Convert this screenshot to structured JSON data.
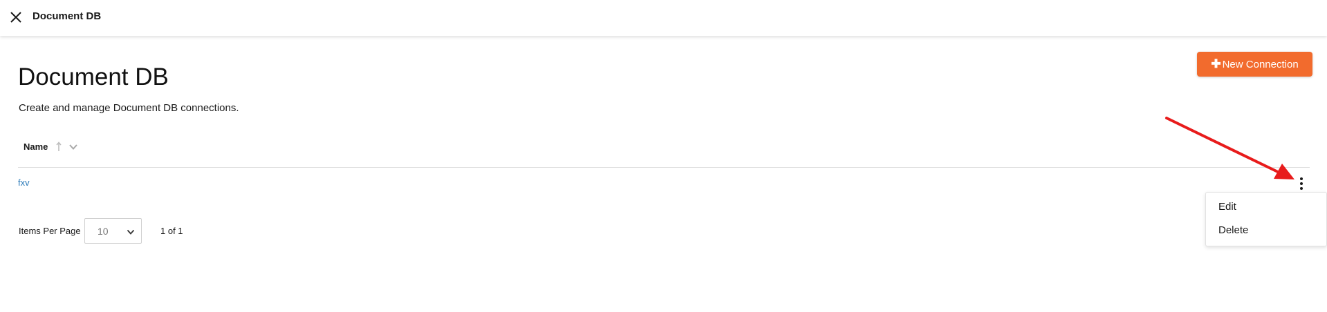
{
  "topbar": {
    "close_icon": "close-icon",
    "title": "Document DB"
  },
  "header": {
    "title": "Document DB",
    "description": "Create and manage Document DB connections.",
    "new_connection": {
      "icon": "plus-icon",
      "label": "New Connection",
      "color": "#f26b2d"
    }
  },
  "table": {
    "columns": [
      {
        "label": "Name",
        "sort": "ascending"
      }
    ],
    "rows": [
      {
        "name": "fxv",
        "link_color": "#2a7ab8"
      }
    ],
    "row_actions_icon": "kebab-icon"
  },
  "context_menu": {
    "items": [
      "Edit",
      "Delete"
    ]
  },
  "annotation": {
    "arrow_color": "#e81b1b"
  },
  "pagination": {
    "items_per_page_label": "Items Per Page",
    "items_per_page_value": "10",
    "page_info": "1 of 1"
  }
}
